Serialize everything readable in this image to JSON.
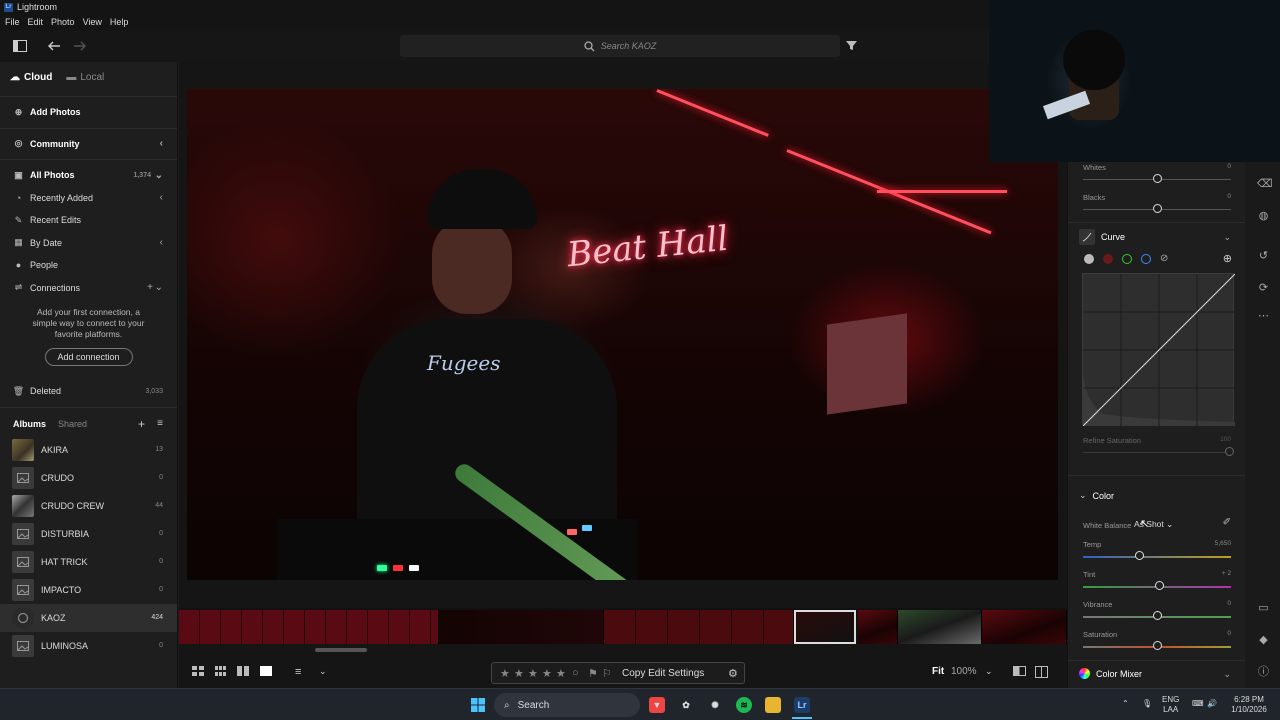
{
  "window": {
    "title": "Lightroom",
    "logo": "Lr"
  },
  "menu": [
    "File",
    "Edit",
    "Photo",
    "View",
    "Help"
  ],
  "search": {
    "placeholder": "Search KAOZ"
  },
  "left": {
    "tabs": {
      "cloud": "Cloud",
      "local": "Local"
    },
    "add_photos": "Add Photos",
    "community": "Community",
    "all_photos": {
      "label": "All Photos",
      "count": "1,374"
    },
    "recently_added": "Recently Added",
    "recent_edits": "Recent Edits",
    "by_date": "By Date",
    "people": "People",
    "connections": "Connections",
    "connect_msg": "Add your first connection, a simple way to connect to your favorite platforms.",
    "add_connection": "Add connection",
    "deleted": {
      "label": "Deleted",
      "count": "3,033"
    },
    "albums_tab": "Albums",
    "shared_tab": "Shared",
    "albums": [
      {
        "name": "AKIRA",
        "count": "13"
      },
      {
        "name": "CRUDO",
        "count": "0"
      },
      {
        "name": "CRUDO CREW",
        "count": "44"
      },
      {
        "name": "DISTURBIA",
        "count": "0"
      },
      {
        "name": "HAT TRICK",
        "count": "0"
      },
      {
        "name": "IMPACTO",
        "count": "0"
      },
      {
        "name": "KAOZ",
        "count": "424"
      },
      {
        "name": "LUMINOSA",
        "count": "0"
      }
    ]
  },
  "photo": {
    "sign_text": "Beat Hall",
    "shirt_text": "Fugees"
  },
  "bottom": {
    "copy_edit": "Copy Edit Settings",
    "fit": "Fit",
    "zoom": "100%"
  },
  "right": {
    "whites": {
      "label": "Whites",
      "value": "0",
      "level": 0.5
    },
    "blacks": {
      "label": "Blacks",
      "value": "0",
      "level": 0.5
    },
    "curve": {
      "title": "Curve",
      "refine_label": "Refine Saturation",
      "refine_value": "100"
    },
    "color": {
      "title": "Color",
      "wb_label": "White Balance",
      "wb_value": "As Shot"
    },
    "temp": {
      "label": "Temp",
      "value": "5,650",
      "level": 0.38
    },
    "tint": {
      "label": "Tint",
      "value": "+ 2",
      "level": 0.52
    },
    "vibrance": {
      "label": "Vibrance",
      "value": "0",
      "level": 0.5
    },
    "saturation": {
      "label": "Saturation",
      "value": "0",
      "level": 0.5
    },
    "color_mixer": "Color Mixer"
  },
  "taskbar": {
    "search": "Search",
    "lang1": "ENG",
    "lang2": "LAA",
    "time": "6:28 PM",
    "date": "1/10/2026"
  },
  "colors": {
    "accent": "#1473e6",
    "panel": "#1e1e1e",
    "neon": "#ff5060"
  }
}
